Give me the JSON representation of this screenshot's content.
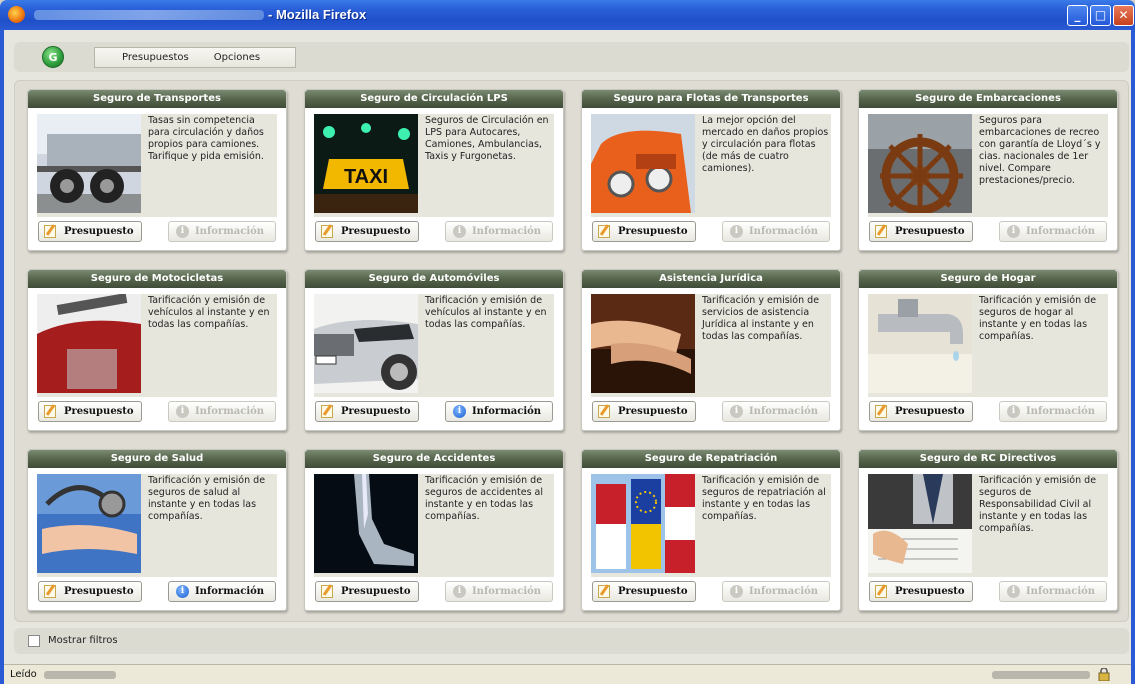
{
  "window": {
    "title": "- Mozilla Firefox",
    "controls": {
      "minimize": "_",
      "maximize": "□",
      "close": "✕"
    }
  },
  "menu": {
    "logo_letter": "G",
    "items": [
      "Presupuestos",
      "Opciones"
    ]
  },
  "cards": [
    {
      "title": "Seguro de Transportes",
      "image": "truck-wheels",
      "description": "Tasas sin competencia para circulación y daños propios para camiones. Tarifique y pida emisión.",
      "presupuesto": "Presupuesto",
      "informacion": "Información",
      "info_enabled": false
    },
    {
      "title": "Seguro de Circulación LPS",
      "image": "taxi-sign",
      "description": "Seguros de Circulación en LPS para Autocares, Camiones, Ambulancias, Taxis y Furgonetas.",
      "presupuesto": "Presupuesto",
      "informacion": "Información",
      "info_enabled": false
    },
    {
      "title": "Seguro para Flotas de Transportes",
      "image": "orange-truck",
      "description": "La mejor opción del mercado en daños propios y circulación para flotas (de más de cuatro camiones).",
      "presupuesto": "Presupuesto",
      "informacion": "Información",
      "info_enabled": false
    },
    {
      "title": "Seguro de Embarcaciones",
      "image": "ship-wheel",
      "description": "Seguros para embarcaciones de recreo con garantía de Lloyd´s y cias. nacionales de 1er nivel. Compare prestaciones/precio.",
      "presupuesto": "Presupuesto",
      "informacion": "Información",
      "info_enabled": false
    },
    {
      "title": "Seguro de Motocicletas",
      "image": "motorcycle",
      "description": "Tarificación y emisión de vehículos al instante y en todas las compañías.",
      "presupuesto": "Presupuesto",
      "informacion": "Información",
      "info_enabled": false
    },
    {
      "title": "Seguro de Automóviles",
      "image": "silver-car",
      "description": "Tarificación y emisión de vehículos al instante y en todas las compañías.",
      "presupuesto": "Presupuesto",
      "informacion": "Información",
      "info_enabled": true
    },
    {
      "title": "Asistencia Jurídica",
      "image": "hands-book",
      "description": "Tarificación y emisión de servicios de asistencia Jurídica al instante y en todas las compañías.",
      "presupuesto": "Presupuesto",
      "informacion": "Información",
      "info_enabled": false
    },
    {
      "title": "Seguro de Hogar",
      "image": "faucet",
      "description": "Tarificación y emisión de seguros de hogar al instante y en todas las compañías.",
      "presupuesto": "Presupuesto",
      "informacion": "Información",
      "info_enabled": false
    },
    {
      "title": "Seguro de Salud",
      "image": "stethoscope",
      "description": "Tarificación y emisión de seguros de salud al instante y en todas las compañías.",
      "presupuesto": "Presupuesto",
      "informacion": "Información",
      "info_enabled": true
    },
    {
      "title": "Seguro de Accidentes",
      "image": "xray",
      "description": "Tarificación y emisión de seguros de accidentes al instante y en todas las compañías.",
      "presupuesto": "Presupuesto",
      "informacion": "Información",
      "info_enabled": false
    },
    {
      "title": "Seguro de Repatriación",
      "image": "flags",
      "description": "Tarificación y emisión de seguros de repatriación al instante y en todas las compañías.",
      "presupuesto": "Presupuesto",
      "informacion": "Información",
      "info_enabled": false
    },
    {
      "title": "Seguro de RC Directivos",
      "image": "signing-document",
      "description": "Tarificación y emisión de seguros de Responsabilidad Civil al instante y en todas las compañías.",
      "presupuesto": "Presupuesto",
      "informacion": "Información",
      "info_enabled": false
    }
  ],
  "filters": {
    "label": "Mostrar filtros"
  },
  "status": {
    "text": "Leído"
  },
  "colors": {
    "header_green": "#56654c",
    "titlebar_blue": "#2a5fd8",
    "info_blue": "#1b5fd0"
  }
}
